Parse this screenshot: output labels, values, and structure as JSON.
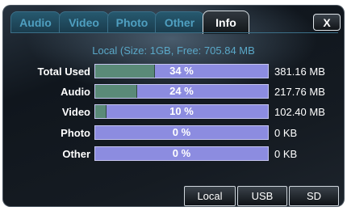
{
  "tabs": [
    {
      "label": "Audio"
    },
    {
      "label": "Video"
    },
    {
      "label": "Photo"
    },
    {
      "label": "Other"
    },
    {
      "label": "Info"
    }
  ],
  "close_label": "X",
  "summary": "Local (Size: 1GB, Free: 705.84 MB",
  "rows": [
    {
      "label": "Total Used",
      "percent_text": "34 %",
      "fill_fraction": 0.34,
      "size": "381.16 MB"
    },
    {
      "label": "Audio",
      "percent_text": "24 %",
      "fill_fraction": 0.24,
      "size": "217.76 MB"
    },
    {
      "label": "Video",
      "percent_text": "10 %",
      "fill_fraction": 0.06,
      "size": "102.40 MB"
    },
    {
      "label": "Photo",
      "percent_text": "0 %",
      "fill_fraction": 0,
      "size": "0 KB"
    },
    {
      "label": "Other",
      "percent_text": "0 %",
      "fill_fraction": 0,
      "size": "0 KB"
    }
  ],
  "sources": [
    {
      "label": "Local"
    },
    {
      "label": "USB"
    },
    {
      "label": "SD"
    }
  ],
  "colors": {
    "bar_bg": "#8c8ce0",
    "bar_fill": "#5a8a78",
    "tab_inactive": "#26596f",
    "summary_text": "#5aa8c8"
  }
}
